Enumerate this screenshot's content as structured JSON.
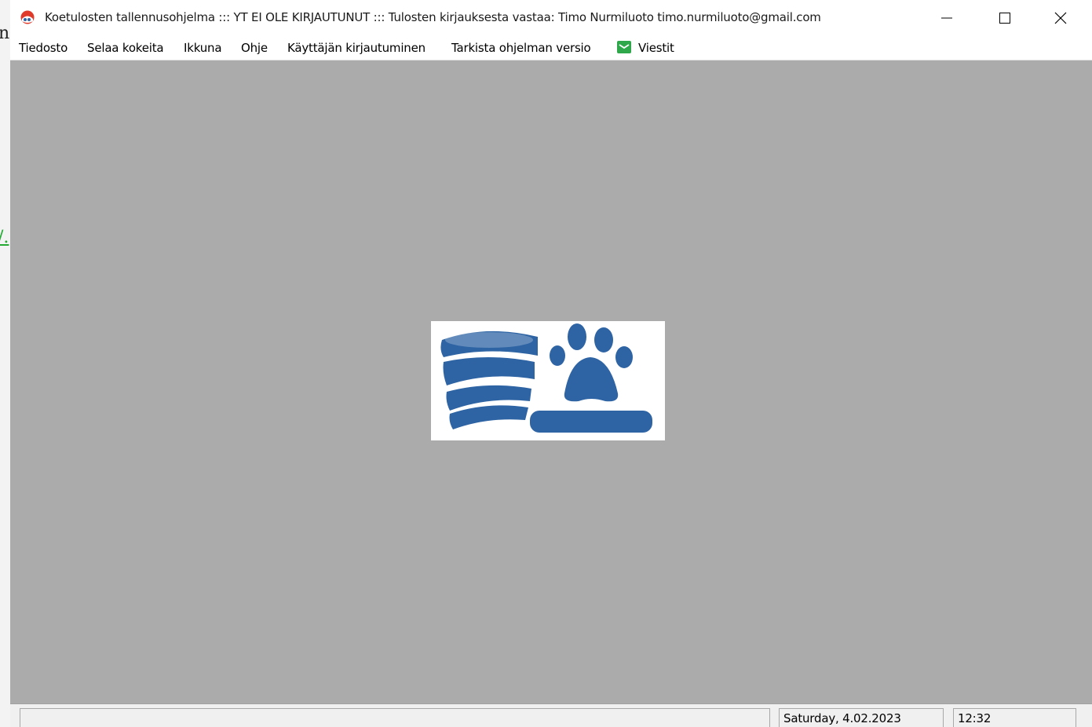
{
  "background": {
    "partial_letter": "n",
    "partial_link": "/."
  },
  "window": {
    "title": "Koetulosten tallennusohjelma   ::: YT EI OLE KIRJAUTUNUT :::  Tulosten kirjauksesta vastaa: Timo Nurmiluoto  timo.nurmiluoto@gmail.com",
    "buttons": {
      "minimize_icon": "minimize-icon",
      "maximize_icon": "maximize-icon",
      "close_icon": "close-icon"
    }
  },
  "menu": {
    "items": [
      "Tiedosto",
      "Selaa kokeita",
      "Ikkuna",
      "Ohje",
      "Käyttäjän kirjautuminen",
      "Tarkista ohjelman versio"
    ],
    "messages_label": "Viestit",
    "messages_icon": "mail-icon"
  },
  "logo": {
    "description_icon": "database-paw-logo",
    "color": "#2e64a4"
  },
  "statusbar": {
    "main_text": "",
    "date": "Saturday,  4.02.2023",
    "time": "12:32"
  }
}
